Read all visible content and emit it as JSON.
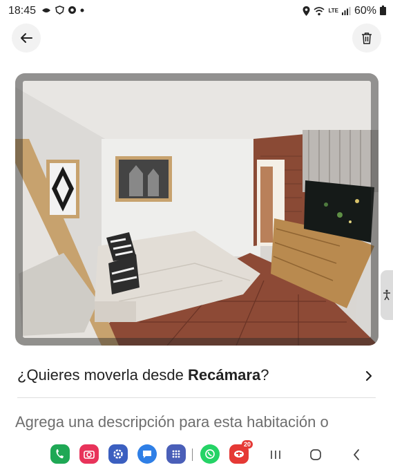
{
  "status_bar": {
    "time": "18:45",
    "battery": "60%",
    "network_label": "LTE"
  },
  "header": {
    "back_icon": "arrow-left-icon",
    "delete_icon": "trash-icon"
  },
  "photo": {
    "description_icon": "bedroom-photo"
  },
  "move_prompt": {
    "prefix": "¿Quieres moverla desde ",
    "room": "Recámara",
    "suffix": "?"
  },
  "description": {
    "placeholder": "Agrega una descripción para esta habitación o"
  },
  "navbar": {
    "apps": [
      {
        "name": "phone-app",
        "color": "#1fa855"
      },
      {
        "name": "camera-app",
        "color": "#e8335a"
      },
      {
        "name": "settings-app",
        "color": "#3b5fc0"
      },
      {
        "name": "messages-app",
        "color": "#2f7fe6"
      },
      {
        "name": "apps-grid",
        "color": "#4a5fb8"
      },
      {
        "name": "whatsapp-app",
        "color": "#25d366"
      },
      {
        "name": "mercado-app",
        "color": "#e53935"
      }
    ],
    "badge": "20"
  }
}
